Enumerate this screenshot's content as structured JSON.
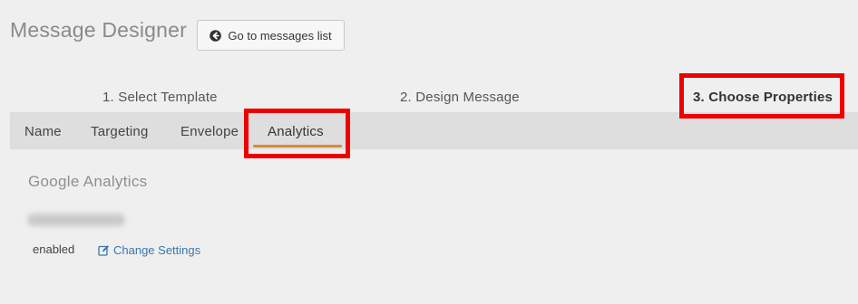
{
  "header": {
    "title": "Message Designer",
    "back_button_label": "Go to messages list",
    "back_icon": "arrow-circle-left-icon"
  },
  "wizard": {
    "steps": [
      {
        "label": "1. Select Template"
      },
      {
        "label": "2. Design Message"
      },
      {
        "label": "3. Choose Properties",
        "active": true
      }
    ]
  },
  "tabs": [
    {
      "label": "Name"
    },
    {
      "label": "Targeting"
    },
    {
      "label": "Envelope"
    },
    {
      "label": "Analytics",
      "active": true
    }
  ],
  "analytics": {
    "heading": "Google Analytics",
    "status": "enabled",
    "change_link_label": "Change Settings",
    "edit_icon": "edit-icon"
  },
  "colors": {
    "background": "#efefef",
    "tab_bar": "#dedede",
    "active_tab_underline": "#d98a3a",
    "highlight": "#ee0000",
    "link": "#3b76a8"
  }
}
